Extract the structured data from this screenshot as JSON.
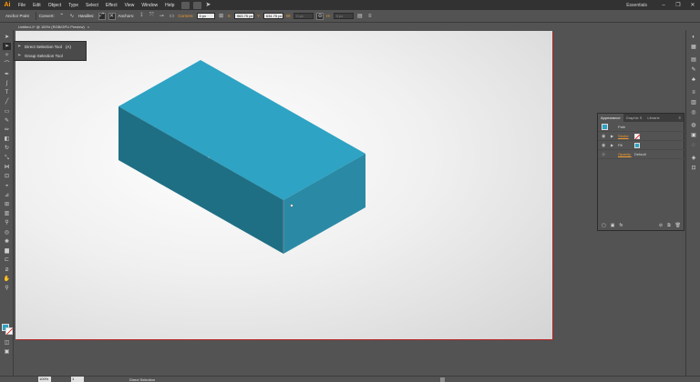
{
  "app": {
    "logo": "Ai"
  },
  "menubar": {
    "items": [
      "File",
      "Edit",
      "Object",
      "Type",
      "Select",
      "Effect",
      "View",
      "Window",
      "Help"
    ],
    "workspace": "Essentials",
    "window_buttons": [
      "–",
      "❐",
      "✕"
    ]
  },
  "controlbar": {
    "anchor_point_label": "Anchor Point",
    "convert_label": "Convert:",
    "handles_label": "Handles:",
    "anchors_label": "Anchors:",
    "corners_label": "Corners:",
    "corners_value": "0 px",
    "x_label": "X:",
    "x_value": "963.75 px",
    "y_label": "Y:",
    "y_value": "634.75 px",
    "w_label": "W:",
    "w_value": "0 px",
    "h_label": "H:",
    "h_value": "0 px"
  },
  "document": {
    "tab_title": "Untitled-1* @ 100% (RGB/GPU Preview)",
    "tab_close": "×"
  },
  "flyout": {
    "items": [
      {
        "label": "Direct Selection Tool",
        "shortcut": "(A)"
      },
      {
        "label": "Group Selection Tool",
        "shortcut": ""
      }
    ]
  },
  "appearance": {
    "tabs": [
      "Appearance",
      "Graphic S",
      "Librarie"
    ],
    "menu_icon": "≡",
    "rows": [
      {
        "label": "Path"
      },
      {
        "label": "Stroke"
      },
      {
        "label": "Fill"
      },
      {
        "label": "Opacity:",
        "value": "Default"
      }
    ],
    "colors": {
      "fill": "#2ea3c4",
      "stroke": "none"
    }
  },
  "colors": {
    "box_top": "#2ea3c4",
    "box_left": "#1f6f84",
    "box_right": "#2a8aa5",
    "artboard_border": "#b52626",
    "accent": "#f29b30"
  },
  "statusbar": {
    "zoom": "100%",
    "page": "1",
    "tool": "Direct Selection"
  }
}
